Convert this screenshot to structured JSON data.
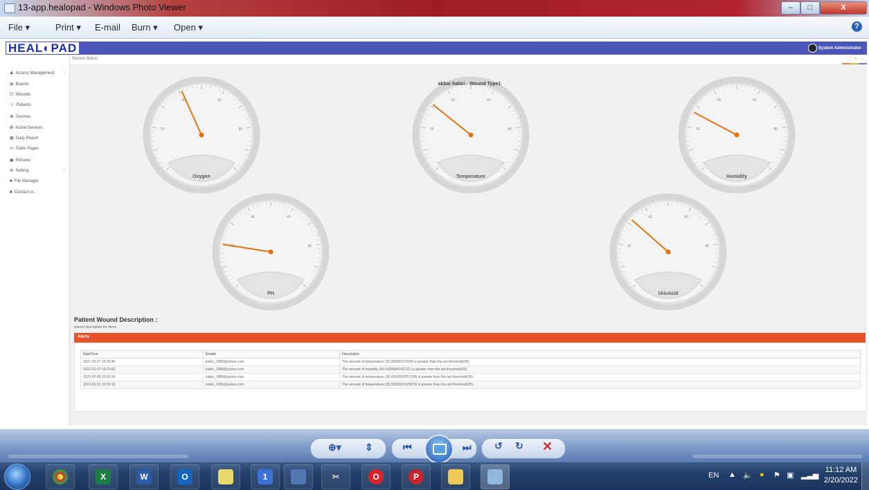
{
  "window": {
    "title": "13-app.healopad - Windows Photo Viewer",
    "controls": [
      "–",
      "□",
      "X"
    ]
  },
  "menu": {
    "items": [
      "File ▾",
      "Print ▾",
      "E-mail",
      "Burn ▾",
      "Open ▾"
    ],
    "help": "?"
  },
  "app": {
    "logo": "HEAL◐PAD",
    "user": "System Administrator",
    "breadcrumb": "Device Status",
    "sidebar": [
      {
        "icon": "person-icon",
        "glyph": "♟",
        "label": "Access Management",
        "chevron": true
      },
      {
        "icon": "boards-icon",
        "glyph": "▤",
        "label": "Boards",
        "chevron": false
      },
      {
        "icon": "wounds-icon",
        "glyph": "☷",
        "label": "Wounds",
        "chevron": false
      },
      {
        "icon": "patients-icon",
        "glyph": "☺",
        "label": "Patients",
        "chevron": false
      },
      {
        "icon": "devices-icon",
        "glyph": "⌘",
        "label": "Devices",
        "chevron": false
      },
      {
        "icon": "active-devices-icon",
        "glyph": "❂",
        "label": "Active Devices",
        "chevron": false
      },
      {
        "icon": "daily-report-icon",
        "glyph": "▦",
        "label": "Daily Report",
        "chevron": false
      },
      {
        "icon": "code-icon",
        "glyph": "‹/›",
        "label": "Static Pages",
        "chevron": false
      },
      {
        "icon": "pictures-icon",
        "glyph": "▣",
        "label": "Pictures",
        "chevron": false
      },
      {
        "icon": "settings-icon",
        "glyph": "⚙",
        "label": "Setting",
        "chevron": true
      },
      {
        "icon": "file-manager-icon",
        "glyph": "■",
        "label": "File Manager",
        "chevron": false
      },
      {
        "icon": "contact-icon",
        "glyph": "■",
        "label": "Contact us",
        "chevron": false
      }
    ],
    "chart_title": "akbar kabiri - Wound Type1",
    "description_heading": "Patient Wound Description :",
    "description_text": "wound description for demo",
    "alerts_title": "Alerts",
    "table": {
      "columns": [
        "DateTime",
        "Emails",
        "Description"
      ],
      "rows": [
        [
          "2022-02-07 16:20:46",
          "kabiri_1986@yahoo.com",
          "The amount of temperature (35.06800137329) is greater than the set threshold(35)."
        ],
        [
          "2022-02-07 16:23:43",
          "kabiri_1986@yahoo.com",
          "The amount of humidity (60.0999984741211) is greater than the set threshold(60)."
        ],
        [
          "2022-02-08 20:00:36",
          "kabiri_1986@yahoo.com",
          "The amount of temperature (35.4300003051758) is greater than the set threshold(35)."
        ],
        [
          "2022-02-01 16:05:19",
          "kabiri_1986@yahoo.com",
          "The amount of temperature (35.5999001525879) is greater than the set threshold(35)."
        ]
      ]
    }
  },
  "chart_data": {
    "type": "gauge",
    "title": "akbar kabiri - Wound Type1",
    "range": [
      0,
      100
    ],
    "tick_labels": [
      "0",
      "20",
      "40",
      "60",
      "80",
      "100"
    ],
    "gauges": [
      {
        "name": "Oxygen",
        "value": 41
      },
      {
        "name": "Temperature",
        "value": 31
      },
      {
        "name": "Humidity",
        "value": 27
      },
      {
        "name": "PH",
        "value": 20
      },
      {
        "name": "UricAcid",
        "value": 32
      }
    ],
    "needle_color": "#e07413"
  },
  "taskbar": {
    "language": "EN",
    "time": "11:12 AM",
    "date": "2/20/2022"
  }
}
